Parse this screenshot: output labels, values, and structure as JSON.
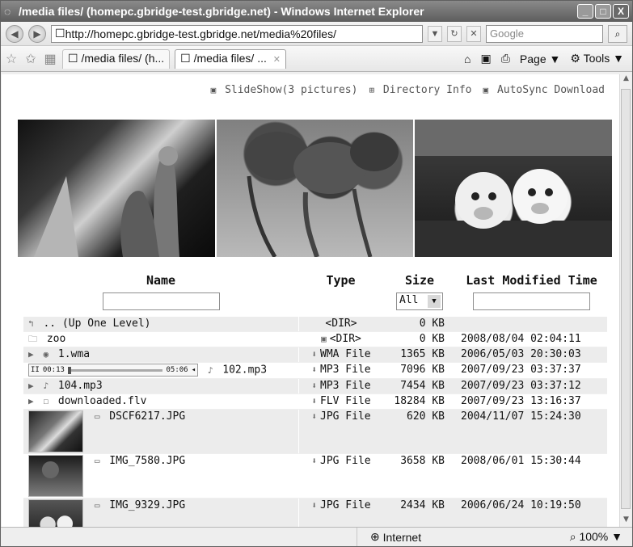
{
  "window": {
    "title": "/media files/ (homepc.gbridge-test.gbridge.net) - Windows Internet Explorer",
    "controls": [
      "_",
      "□",
      "X"
    ]
  },
  "address_bar": {
    "url": "http://homepc.gbridge-test.gbridge.net/media%20files/",
    "search_placeholder": "Google"
  },
  "tabs": [
    {
      "label": "/media files/ (h...",
      "active": false
    },
    {
      "label": "/media files/ ...",
      "active": true
    }
  ],
  "toolbar": {
    "page_label": "Page",
    "tools_label": "Tools"
  },
  "status": {
    "zone": "Internet",
    "zoom": "100%"
  },
  "page_links": [
    {
      "label": "SlideShow(3 pictures)",
      "icon": "slideshow-icon"
    },
    {
      "label": "Directory Info",
      "icon": "directory-info-icon"
    },
    {
      "label": "AutoSync Download",
      "icon": "autosync-icon"
    }
  ],
  "headers": {
    "name": "Name",
    "type": "Type",
    "size": "Size",
    "last_modified": "Last Modified Time",
    "size_filter": "All"
  },
  "rows": [
    {
      "name": ".. (Up One Level)",
      "type": "<DIR>",
      "size": "0 KB",
      "modified": "",
      "icon": "up-level-icon"
    },
    {
      "name": "zoo",
      "type": "<DIR>",
      "size": "0 KB",
      "modified": "2008/08/04 02:04:11",
      "icon": "folder-icon"
    },
    {
      "name": "1.wma",
      "type": "WMA File",
      "size": "1365 KB",
      "modified": "2006/05/03 20:30:03",
      "icon": "audio-icon"
    },
    {
      "name": "102.mp3",
      "type": "MP3 File",
      "size": "7096 KB",
      "modified": "2007/09/23 03:37:37",
      "icon": "music-icon",
      "player": {
        "current": "00:13",
        "duration": "05:06"
      }
    },
    {
      "name": "104.mp3",
      "type": "MP3 File",
      "size": "7454 KB",
      "modified": "2007/09/23 03:37:12",
      "icon": "music-icon"
    },
    {
      "name": "downloaded.flv",
      "type": "FLV File",
      "size": "18284 KB",
      "modified": "2007/09/23 13:16:37",
      "icon": "file-icon"
    },
    {
      "name": "DSCF6217.JPG",
      "type": "JPG File",
      "size": "620 KB",
      "modified": "2004/11/07 15:24:30",
      "icon": "image-icon"
    },
    {
      "name": "IMG_7580.JPG",
      "type": "JPG File",
      "size": "3658 KB",
      "modified": "2008/06/01 15:30:44",
      "icon": "image-icon"
    },
    {
      "name": "IMG_9329.JPG",
      "type": "JPG File",
      "size": "2434 KB",
      "modified": "2006/06/24 10:19:50",
      "icon": "image-icon"
    }
  ]
}
